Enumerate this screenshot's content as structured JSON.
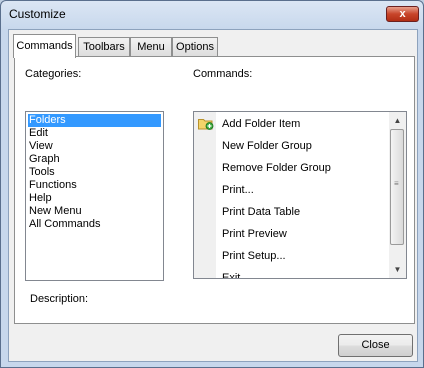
{
  "window": {
    "title": "Customize",
    "close_glyph": "x"
  },
  "tabs": [
    {
      "label": "Commands",
      "active": true
    },
    {
      "label": "Toolbars",
      "active": false
    },
    {
      "label": "Menu",
      "active": false
    },
    {
      "label": "Options",
      "active": false
    }
  ],
  "categories": {
    "label": "Categories:",
    "items": [
      "Folders",
      "Edit",
      "View",
      "Graph",
      "Tools",
      "Functions",
      "Help",
      "New Menu",
      "All Commands"
    ],
    "selected": "Folders"
  },
  "commands": {
    "label": "Commands:",
    "items": [
      "Add Folder Item",
      "New Folder Group",
      "Remove Folder Group",
      "Print...",
      "Print Data Table",
      "Print Preview",
      "Print Setup...",
      "Exit"
    ],
    "first_item_icon": "folder-add-icon"
  },
  "description": {
    "label": "Description:"
  },
  "footer": {
    "close_label": "Close"
  }
}
